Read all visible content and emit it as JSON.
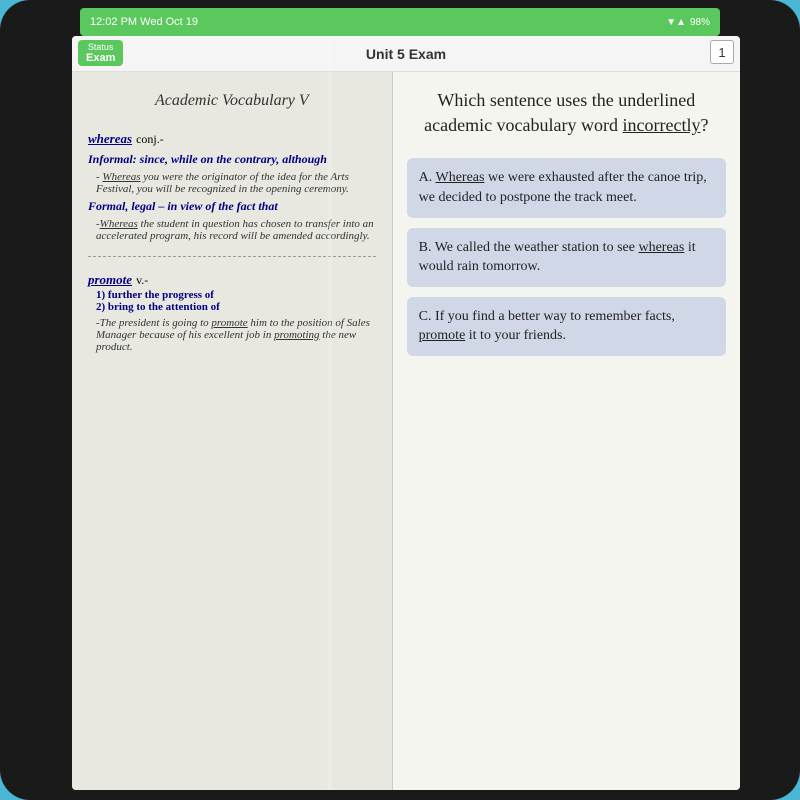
{
  "device": {
    "status_bar": {
      "time": "12:02 PM  Wed Oct 19",
      "battery": "98%",
      "wifi": "▼▲"
    },
    "three_dots": "• • •"
  },
  "header": {
    "title": "Unit 5 Exam",
    "status_label": "Status",
    "status_value": "Exam",
    "page_number": "1"
  },
  "left_panel": {
    "title": "Academic Vocabulary V",
    "word1": {
      "word": "whereas",
      "pos": "conj.-",
      "def1_label": "Informal: since, while on the contrary, although",
      "def1_example": "- Whereas you were the originator of the idea for the Arts Festival, you will be recognized in the opening ceremony.",
      "def1_example_underline": "Whereas",
      "def2_label": "Formal, legal – in view of the fact that",
      "def2_example": "-Whereas the student in question has chosen to transfer into an accelerated program, his record will be amended accordingly.",
      "def2_example_underline": "Whereas"
    },
    "word2": {
      "word": "promote",
      "pos": "v.-",
      "def1": "1) further the progress of",
      "def2": "2) bring to the attention of",
      "example": "-The president is going to promote him to the position of Sales Manager because of his excellent job in promoting the new product.",
      "example_underline1": "promote",
      "example_underline2": "promoting"
    }
  },
  "right_panel": {
    "question": "Which sentence uses the underlined academic vocabulary word incorrectly?",
    "question_underline": "incorrectly",
    "options": [
      {
        "letter": "A.",
        "text": " Whereas we were exhausted after the canoe trip, we decided to postpone the track meet.",
        "underline": "Whereas"
      },
      {
        "letter": "B.",
        "text": " We called the weather station to see whereas it would rain tomorrow.",
        "underline": "whereas"
      },
      {
        "letter": "C.",
        "text": " If you find a better way to remember facts, promote it to your friends.",
        "underline": "promote"
      }
    ]
  }
}
